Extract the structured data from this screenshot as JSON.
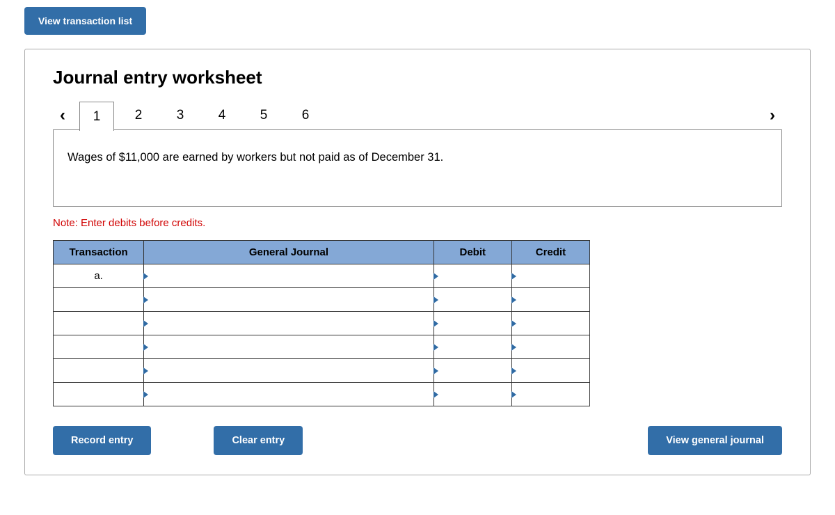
{
  "top": {
    "view_list_label": "View transaction list"
  },
  "panel": {
    "title": "Journal entry worksheet",
    "tabs": [
      "1",
      "2",
      "3",
      "4",
      "5",
      "6"
    ],
    "active_tab_index": 0,
    "description": "Wages of $11,000 are earned by workers but not paid as of December 31.",
    "note": "Note: Enter debits before credits."
  },
  "table": {
    "headers": {
      "transaction": "Transaction",
      "journal": "General Journal",
      "debit": "Debit",
      "credit": "Credit"
    },
    "rows": [
      {
        "transaction": "a.",
        "journal": "",
        "debit": "",
        "credit": ""
      },
      {
        "transaction": "",
        "journal": "",
        "debit": "",
        "credit": ""
      },
      {
        "transaction": "",
        "journal": "",
        "debit": "",
        "credit": ""
      },
      {
        "transaction": "",
        "journal": "",
        "debit": "",
        "credit": ""
      },
      {
        "transaction": "",
        "journal": "",
        "debit": "",
        "credit": ""
      },
      {
        "transaction": "",
        "journal": "",
        "debit": "",
        "credit": ""
      }
    ]
  },
  "actions": {
    "record": "Record entry",
    "clear": "Clear entry",
    "view_journal": "View general journal"
  }
}
